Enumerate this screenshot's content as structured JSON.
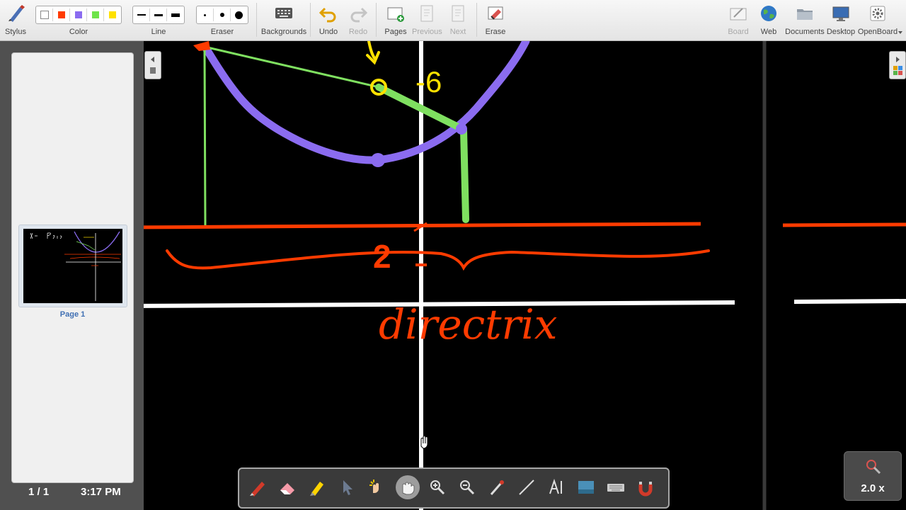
{
  "toolbar": {
    "stylus": "Stylus",
    "color": "Color",
    "line": "Line",
    "eraser": "Eraser",
    "backgrounds": "Backgrounds",
    "undo": "Undo",
    "redo": "Redo",
    "pages": "Pages",
    "previous": "Previous",
    "next": "Next",
    "erase": "Erase",
    "board": "Board",
    "web": "Web",
    "documents": "Documents",
    "desktop": "Desktop",
    "openboard": "OpenBoard",
    "colors": [
      "#ffffff",
      "#ff3b00",
      "#8b6cf0",
      "#6ee44a",
      "#ffe100"
    ]
  },
  "sidebar": {
    "page_label": "Page 1",
    "page_count": "1 / 1",
    "clock": "3:17 PM"
  },
  "board": {
    "neg_six": "-6",
    "two": "2",
    "directrix": "directrix"
  },
  "zoom": {
    "value": "2.0 x"
  },
  "colors": {
    "parabola": "#8b6cf0",
    "green": "#7fe060",
    "red": "#ff3b00",
    "yellow": "#ffe100",
    "axis": "#ffffff"
  }
}
